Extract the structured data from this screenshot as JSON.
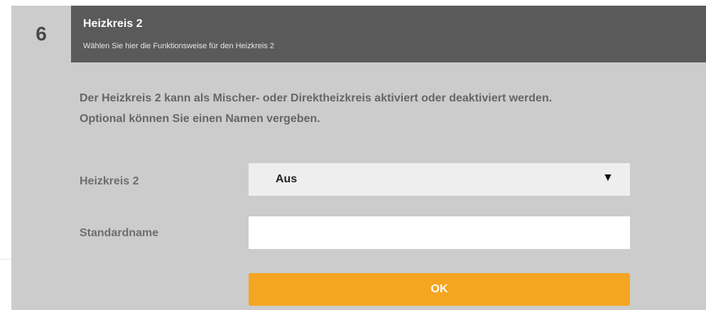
{
  "step": {
    "number": "6",
    "title": "Heizkreis 2",
    "subtitle": "Wählen Sie hier die Funktionsweise für den Heizkreis 2"
  },
  "description": {
    "line1": "Der Heizkreis 2 kann als Mischer- oder Direktheizkreis aktiviert oder deaktiviert werden.",
    "line2": "Optional können Sie einen Namen vergeben."
  },
  "form": {
    "heizkreis": {
      "label": "Heizkreis 2",
      "selected": "Aus",
      "arrow_icon": "dropdown-triangle-icon"
    },
    "standardname": {
      "label": "Standardname",
      "value": "",
      "placeholder": ""
    },
    "ok_label": "OK"
  },
  "colors": {
    "panel_bg": "#cccccc",
    "header_bg": "#5a5a5a",
    "button_bg": "#f5a521"
  }
}
